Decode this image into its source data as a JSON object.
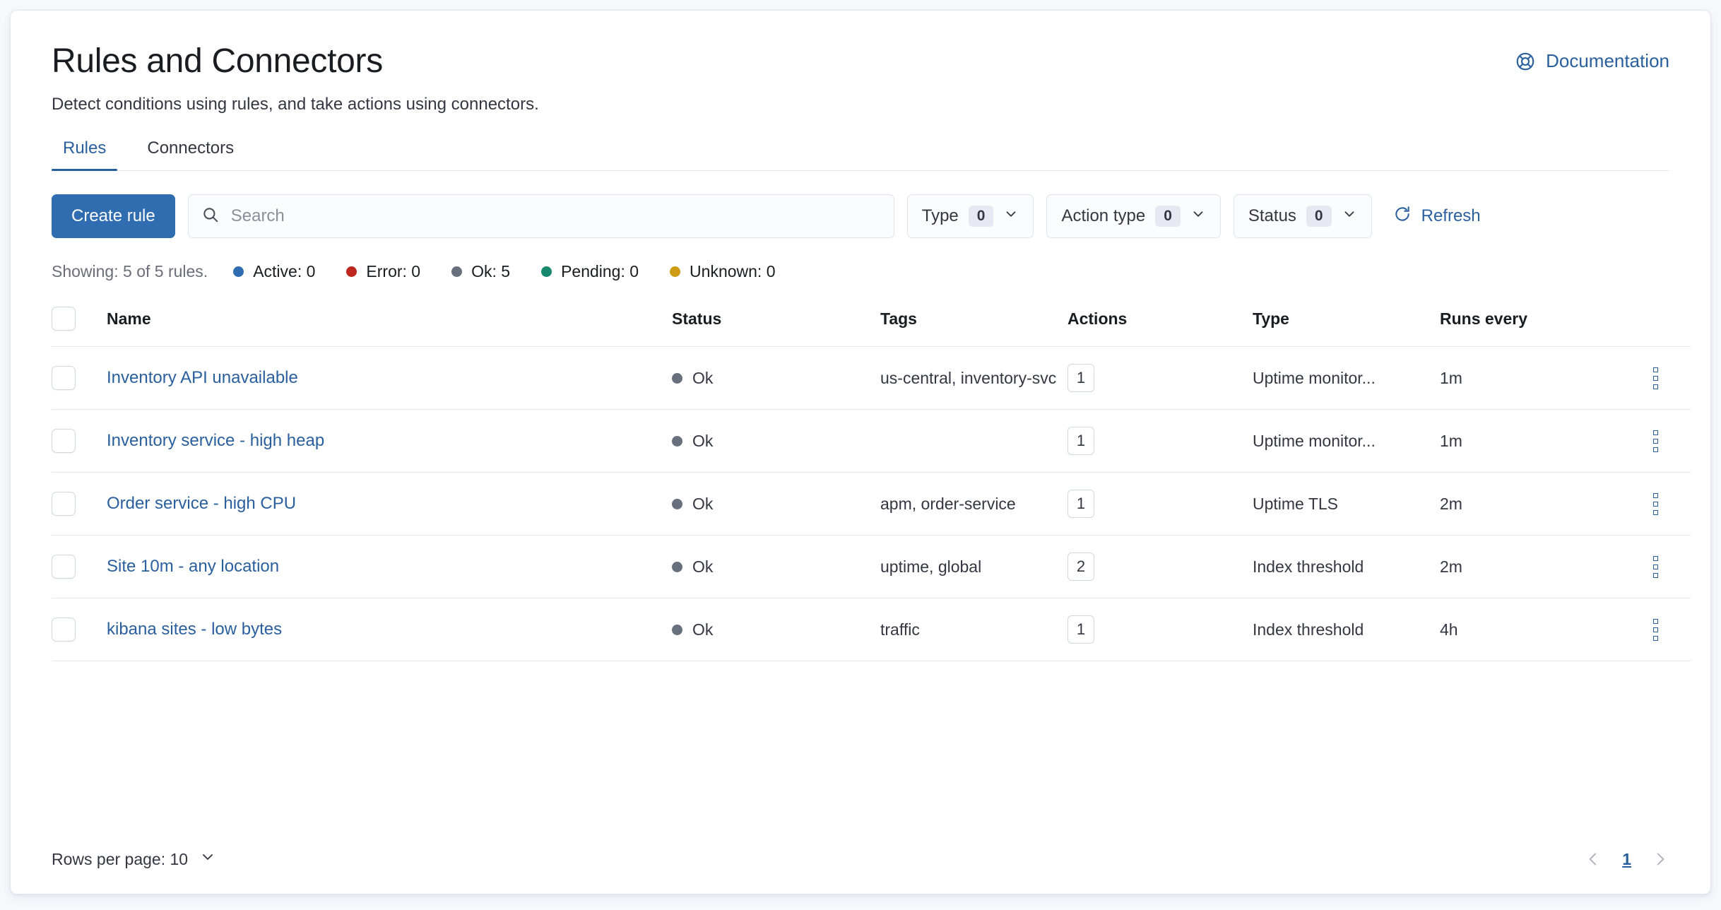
{
  "header": {
    "title": "Rules and Connectors",
    "subtitle": "Detect conditions using rules, and take actions using connectors.",
    "documentation_label": "Documentation"
  },
  "tabs": [
    {
      "label": "Rules",
      "active": true
    },
    {
      "label": "Connectors",
      "active": false
    }
  ],
  "toolbar": {
    "create_rule_label": "Create rule",
    "search_placeholder": "Search",
    "search_value": "",
    "filters": [
      {
        "label": "Type",
        "count": "0"
      },
      {
        "label": "Action type",
        "count": "0"
      },
      {
        "label": "Status",
        "count": "0"
      }
    ],
    "refresh_label": "Refresh"
  },
  "summary": {
    "showing_text": "Showing: 5 of 5 rules.",
    "stats": [
      {
        "label": "Active: 0",
        "color": "#2f6cb0"
      },
      {
        "label": "Error: 0",
        "color": "#bd271e"
      },
      {
        "label": "Ok: 5",
        "color": "#69707d"
      },
      {
        "label": "Pending: 0",
        "color": "#17876d"
      },
      {
        "label": "Unknown: 0",
        "color": "#cc9c14"
      }
    ]
  },
  "table": {
    "columns": [
      "Name",
      "Status",
      "Tags",
      "Actions",
      "Type",
      "Runs every"
    ],
    "rows": [
      {
        "name": "Inventory API unavailable",
        "status": "Ok",
        "status_color": "#69707d",
        "tags": "us-central, inventory-svc",
        "actions": "1",
        "type": "Uptime monitor...",
        "runs_every": "1m"
      },
      {
        "name": "Inventory service - high heap",
        "status": "Ok",
        "status_color": "#69707d",
        "tags": "",
        "actions": "1",
        "type": "Uptime monitor...",
        "runs_every": "1m"
      },
      {
        "name": "Order service - high CPU",
        "status": "Ok",
        "status_color": "#69707d",
        "tags": "apm, order-service",
        "actions": "1",
        "type": "Uptime TLS",
        "runs_every": "2m"
      },
      {
        "name": "Site 10m - any location",
        "status": "Ok",
        "status_color": "#69707d",
        "tags": "uptime, global",
        "actions": "2",
        "type": "Index threshold",
        "runs_every": "2m"
      },
      {
        "name": "kibana sites - low bytes",
        "status": "Ok",
        "status_color": "#69707d",
        "tags": "traffic",
        "actions": "1",
        "type": "Index threshold",
        "runs_every": "4h"
      }
    ]
  },
  "footer": {
    "rows_per_page_label": "Rows per page: 10",
    "current_page": "1"
  },
  "colors": {
    "accent": "#2a5f9e",
    "primary_button": "#2f6cb0",
    "border": "#e3e6ef",
    "text": "#343741",
    "muted": "#6a6e78",
    "page_background": "#f7f8fc"
  }
}
